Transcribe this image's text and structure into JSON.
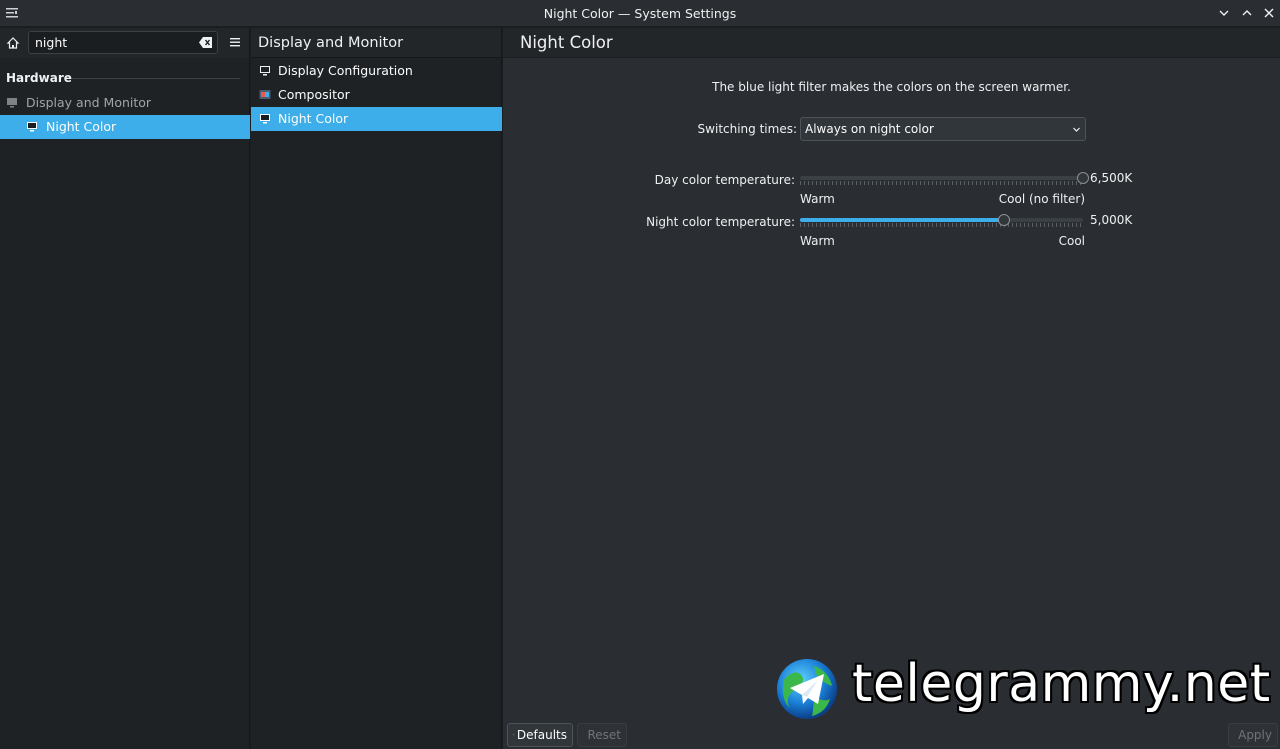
{
  "window": {
    "title": "Night Color — System Settings"
  },
  "sidebar": {
    "search": {
      "value": "night",
      "placeholder": ""
    },
    "category": "Hardware",
    "items": [
      {
        "label": "Display and Monitor",
        "icon": "monitor-icon"
      },
      {
        "label": "Night Color",
        "icon": "night-color-icon"
      }
    ]
  },
  "sublist": {
    "title": "Display and Monitor",
    "items": [
      {
        "label": "Display Configuration",
        "icon": "monitor-icon"
      },
      {
        "label": "Compositor",
        "icon": "compositor-icon"
      },
      {
        "label": "Night Color",
        "icon": "night-color-icon"
      }
    ]
  },
  "main": {
    "title": "Night Color",
    "description": "The blue light filter makes the colors on the screen warmer.",
    "switching": {
      "label": "Switching times:",
      "value": "Always on night color"
    },
    "day_temp": {
      "label": "Day color temperature:",
      "value_text": "6,500K",
      "min_label": "Warm",
      "max_label": "Cool (no filter)",
      "fraction": 1.0
    },
    "night_temp": {
      "label": "Night color temperature:",
      "value_text": "5,000K",
      "min_label": "Warm",
      "max_label": "Cool",
      "fraction": 0.72
    }
  },
  "footer": {
    "defaults": "Defaults",
    "reset": "Reset",
    "apply": "Apply"
  },
  "watermark": {
    "text": "telegrammy.net"
  },
  "colors": {
    "accent": "#3daee9",
    "background": "#2a2e32",
    "sidebar": "#1f2225"
  }
}
